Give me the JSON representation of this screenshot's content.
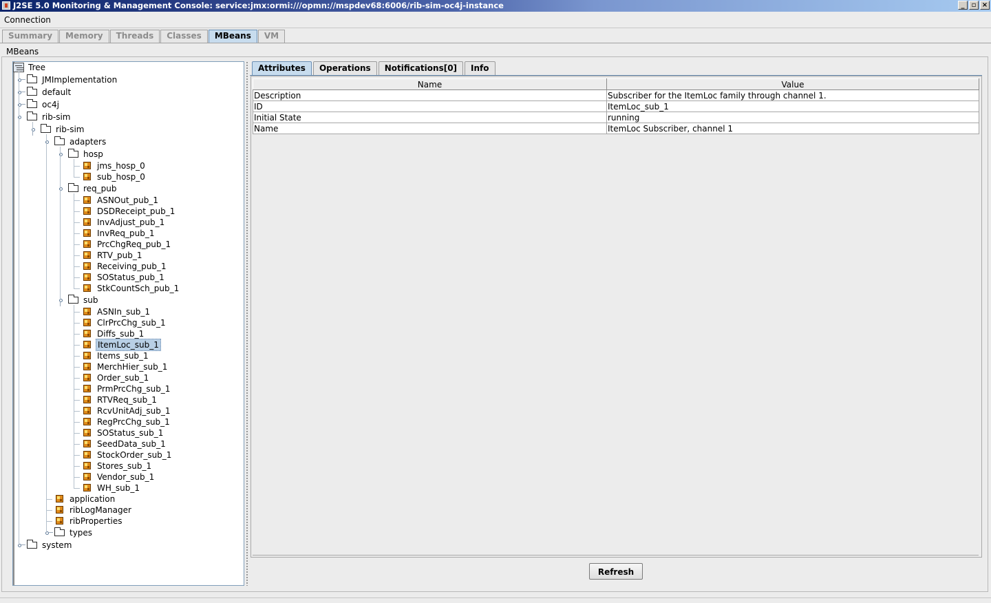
{
  "window": {
    "title": "J2SE 5.0 Monitoring & Management Console: service:jmx:ormi:///opmn://mspdev68:6006/rib-sim-oc4j-instance",
    "controls": [
      "minimize",
      "restore",
      "close"
    ]
  },
  "menu": {
    "items": [
      "Connection"
    ]
  },
  "main_tabs": [
    "Summary",
    "Memory",
    "Threads",
    "Classes",
    "MBeans",
    "VM"
  ],
  "main_tab_active": "MBeans",
  "mbeans": {
    "label": "MBeans",
    "tree_root": "Tree",
    "tree": [
      {
        "label": "JMImplementation",
        "type": "folder",
        "level": 0,
        "expander": "closed"
      },
      {
        "label": "default",
        "type": "folder",
        "level": 0,
        "expander": "closed"
      },
      {
        "label": "oc4j",
        "type": "folder",
        "level": 0,
        "expander": "closed"
      },
      {
        "label": "rib-sim",
        "type": "folder",
        "level": 0,
        "expander": "open"
      },
      {
        "label": "rib-sim",
        "type": "folder",
        "level": 1,
        "expander": "open"
      },
      {
        "label": "adapters",
        "type": "folder",
        "level": 2,
        "expander": "open"
      },
      {
        "label": "hosp",
        "type": "folder",
        "level": 3,
        "expander": "open"
      },
      {
        "label": "jms_hosp_0",
        "type": "bean",
        "level": 4
      },
      {
        "label": "sub_hosp_0",
        "type": "bean",
        "level": 4
      },
      {
        "label": "req_pub",
        "type": "folder",
        "level": 3,
        "expander": "open"
      },
      {
        "label": "ASNOut_pub_1",
        "type": "bean",
        "level": 4
      },
      {
        "label": "DSDReceipt_pub_1",
        "type": "bean",
        "level": 4
      },
      {
        "label": "InvAdjust_pub_1",
        "type": "bean",
        "level": 4
      },
      {
        "label": "InvReq_pub_1",
        "type": "bean",
        "level": 4
      },
      {
        "label": "PrcChgReq_pub_1",
        "type": "bean",
        "level": 4
      },
      {
        "label": "RTV_pub_1",
        "type": "bean",
        "level": 4
      },
      {
        "label": "Receiving_pub_1",
        "type": "bean",
        "level": 4
      },
      {
        "label": "SOStatus_pub_1",
        "type": "bean",
        "level": 4
      },
      {
        "label": "StkCountSch_pub_1",
        "type": "bean",
        "level": 4
      },
      {
        "label": "sub",
        "type": "folder",
        "level": 3,
        "expander": "open"
      },
      {
        "label": "ASNIn_sub_1",
        "type": "bean",
        "level": 4
      },
      {
        "label": "ClrPrcChg_sub_1",
        "type": "bean",
        "level": 4
      },
      {
        "label": "Diffs_sub_1",
        "type": "bean",
        "level": 4
      },
      {
        "label": "ItemLoc_sub_1",
        "type": "bean",
        "level": 4,
        "selected": true
      },
      {
        "label": "Items_sub_1",
        "type": "bean",
        "level": 4
      },
      {
        "label": "MerchHier_sub_1",
        "type": "bean",
        "level": 4
      },
      {
        "label": "Order_sub_1",
        "type": "bean",
        "level": 4
      },
      {
        "label": "PrmPrcChg_sub_1",
        "type": "bean",
        "level": 4
      },
      {
        "label": "RTVReq_sub_1",
        "type": "bean",
        "level": 4
      },
      {
        "label": "RcvUnitAdj_sub_1",
        "type": "bean",
        "level": 4
      },
      {
        "label": "RegPrcChg_sub_1",
        "type": "bean",
        "level": 4
      },
      {
        "label": "SOStatus_sub_1",
        "type": "bean",
        "level": 4
      },
      {
        "label": "SeedData_sub_1",
        "type": "bean",
        "level": 4
      },
      {
        "label": "StockOrder_sub_1",
        "type": "bean",
        "level": 4
      },
      {
        "label": "Stores_sub_1",
        "type": "bean",
        "level": 4
      },
      {
        "label": "Vendor_sub_1",
        "type": "bean",
        "level": 4
      },
      {
        "label": "WH_sub_1",
        "type": "bean",
        "level": 4
      },
      {
        "label": "application",
        "type": "bean",
        "level": 2
      },
      {
        "label": "ribLogManager",
        "type": "bean",
        "level": 2
      },
      {
        "label": "ribProperties",
        "type": "bean",
        "level": 2
      },
      {
        "label": "types",
        "type": "folder",
        "level": 2,
        "expander": "closed"
      },
      {
        "label": "system",
        "type": "folder",
        "level": 0,
        "expander": "closed"
      }
    ]
  },
  "detail_tabs": [
    "Attributes",
    "Operations",
    "Notifications[0]",
    "Info"
  ],
  "detail_tab_active": "Attributes",
  "attributes": {
    "columns": [
      "Name",
      "Value"
    ],
    "rows": [
      [
        "Description",
        "Subscriber for the ItemLoc family through channel 1."
      ],
      [
        "ID",
        "ItemLoc_sub_1"
      ],
      [
        "Initial State",
        "running"
      ],
      [
        "Name",
        "ItemLoc Subscriber, channel 1"
      ]
    ]
  },
  "refresh_label": "Refresh",
  "colors": {
    "tab_active": "#c7dcee",
    "selection": "#b8cfe5",
    "bean_icon": "#e08a1a"
  }
}
